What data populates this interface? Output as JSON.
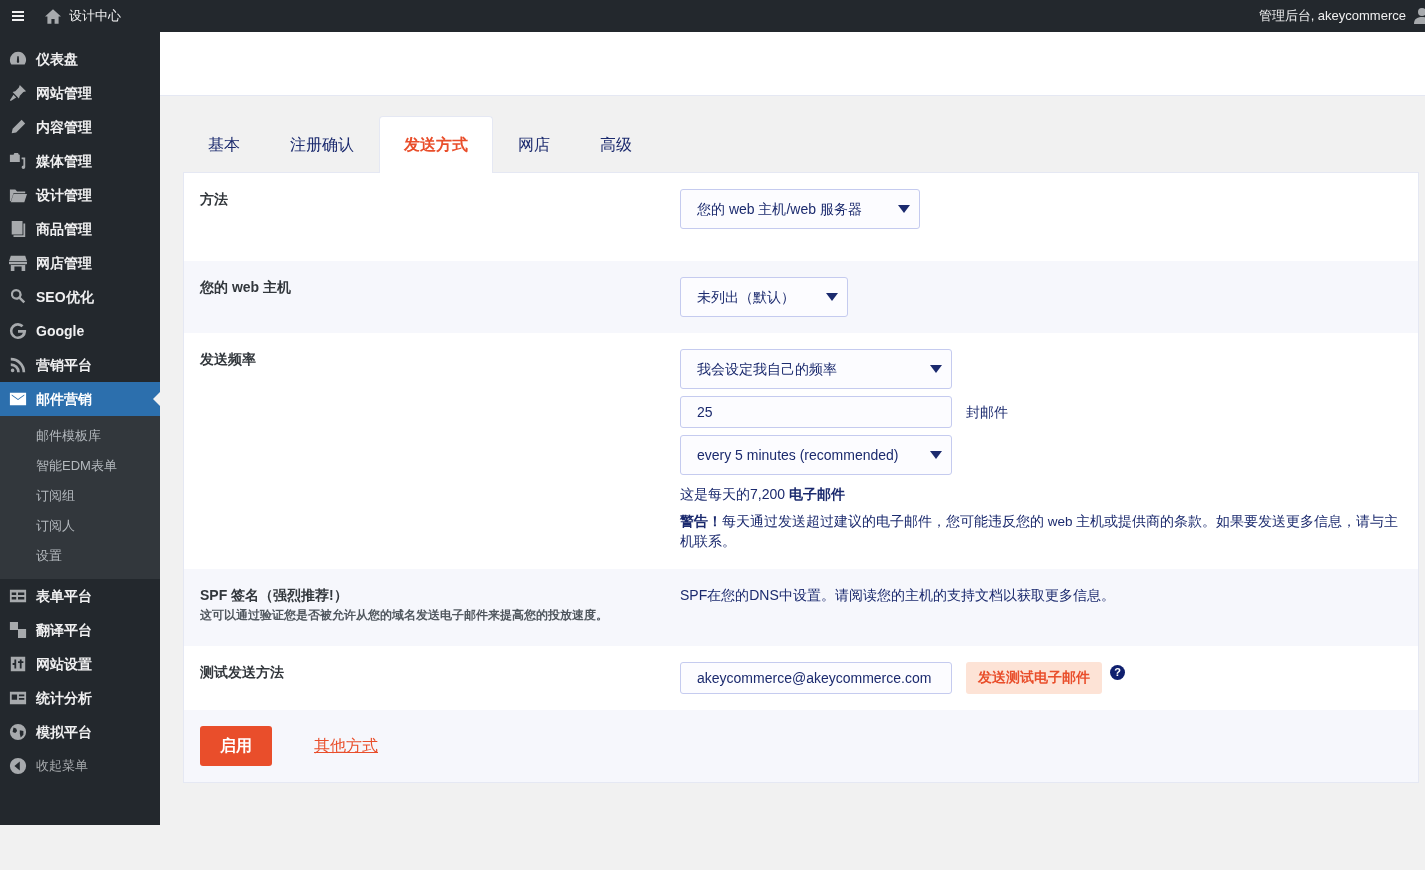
{
  "topbar": {
    "site": "设计中心",
    "account": "管理后台, akeycommerce"
  },
  "sidebar": {
    "items": [
      {
        "label": "仪表盘",
        "selected": false
      },
      {
        "label": "网站管理",
        "selected": false
      },
      {
        "label": "内容管理",
        "selected": false
      },
      {
        "label": "媒体管理",
        "selected": false
      },
      {
        "label": "设计管理",
        "selected": false
      },
      {
        "label": "商品管理",
        "selected": false
      },
      {
        "label": "网店管理",
        "selected": false
      },
      {
        "label": "SEO优化",
        "selected": false
      },
      {
        "label": "Google",
        "selected": false
      },
      {
        "label": "营销平台",
        "selected": false
      },
      {
        "label": "邮件营销",
        "selected": true,
        "expanded": true,
        "children": [
          {
            "label": "邮件模板库"
          },
          {
            "label": "智能EDM表单"
          },
          {
            "label": "订阅组"
          },
          {
            "label": "订阅人"
          },
          {
            "label": "设置"
          }
        ]
      },
      {
        "label": "表单平台",
        "selected": false
      },
      {
        "label": "翻译平台",
        "selected": false
      },
      {
        "label": "网站设置",
        "selected": false
      },
      {
        "label": "统计分析",
        "selected": false
      },
      {
        "label": "模拟平台",
        "selected": false
      }
    ],
    "collapse": "收起菜单"
  },
  "tabs": [
    {
      "label": "基本",
      "selected": false
    },
    {
      "label": "注册确认",
      "selected": false
    },
    {
      "label": "发送方式",
      "selected": true
    },
    {
      "label": "网店",
      "selected": false
    },
    {
      "label": "高级",
      "selected": false
    }
  ],
  "rows": [
    {
      "kind": "select",
      "label": "方法",
      "value": "您的 web 主机/web 服务器"
    },
    {
      "kind": "select",
      "label": "您的 web 主机",
      "value": "未列出（默认）"
    },
    {
      "kind": "frequency",
      "label": "发送频率",
      "mode": "我会设定我自己的频率",
      "count": "25",
      "count_unit": "封邮件",
      "interval": "every 5 minutes (recommended)",
      "summary": "这是每天的7,200 **电子邮件**",
      "warning": "**警告！**每天通过发送超过建议的电子邮件，您可能违反您的 web 主机或提供商的条款。如果要发送更多信息，请与主机联系。"
    },
    {
      "kind": "info",
      "label": "SPF 签名（强烈推荐!）",
      "description": "这可以通过验证您是否被允许从您的域名发送电子邮件来提高您的投放速度。",
      "text": "SPF在您的DNS中设置。请阅读您的主机的支持文档以获取更多信息。"
    },
    {
      "kind": "test",
      "label": "测试发送方法",
      "email": "akeycommerce@akeycommerce.com",
      "button": "发送测试电子邮件",
      "help": "?"
    }
  ],
  "footer": {
    "primary": "启用",
    "link": "其他方式"
  }
}
